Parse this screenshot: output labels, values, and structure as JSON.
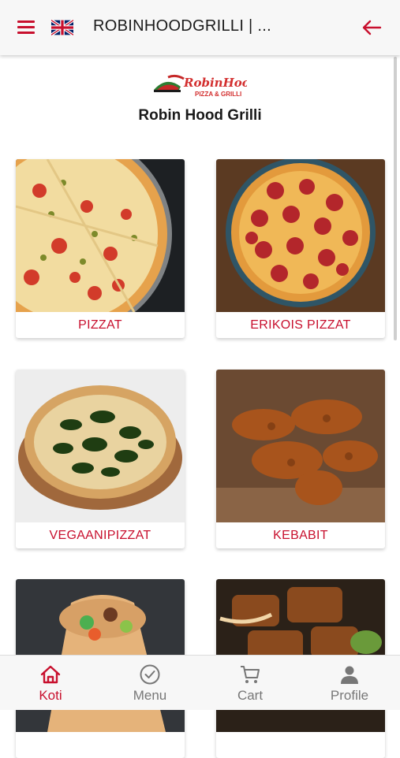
{
  "header": {
    "title": "ROBINHOODGRILLI | ...",
    "language": "English (UK flag)",
    "menu_icon": "hamburger-menu-icon",
    "back_icon": "arrow-left-icon"
  },
  "logo": {
    "brand": "RobinHood",
    "tagline": "PIZZA & GRILLI"
  },
  "restaurant": {
    "name": "Robin Hood Grilli"
  },
  "categories": [
    {
      "label": "PIZZAT"
    },
    {
      "label": "ERIKOIS PIZZAT"
    },
    {
      "label": "VEGAANIPIZZAT"
    },
    {
      "label": "KEBABIT"
    },
    {
      "label": ""
    },
    {
      "label": ""
    }
  ],
  "bottom_nav": {
    "items": [
      {
        "label": "Koti",
        "icon": "home-icon",
        "active": true
      },
      {
        "label": "Menu",
        "icon": "check-circle-icon",
        "active": false
      },
      {
        "label": "Cart",
        "icon": "cart-icon",
        "active": false
      },
      {
        "label": "Profile",
        "icon": "person-icon",
        "active": false
      }
    ]
  },
  "colors": {
    "accent": "#c8102e",
    "inactive": "#777777",
    "bar_bg": "#f7f7f7"
  }
}
